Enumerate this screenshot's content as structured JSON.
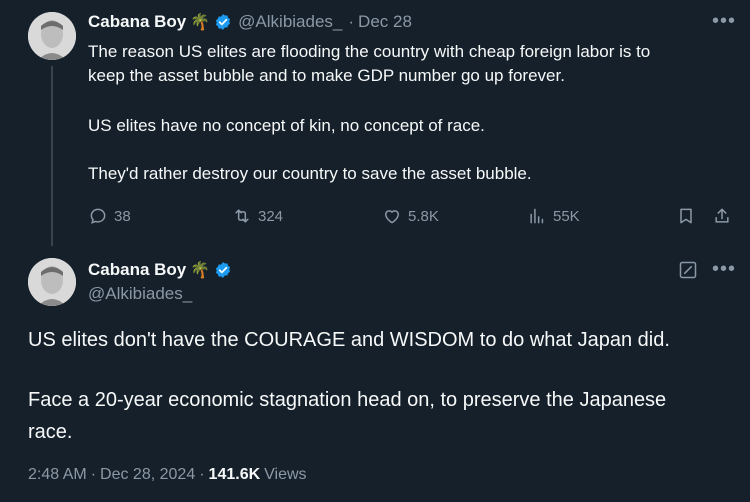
{
  "tweet1": {
    "name": "Cabana Boy",
    "handle": "@Alkibiades_",
    "separator": "·",
    "date": "Dec 28",
    "para1": "The reason US elites are flooding the country with cheap foreign labor is to",
    "para1b": "keep the asset bubble and to make GDP number go up forever.",
    "para2": "US elites have no concept of kin, no concept of race.",
    "para3": "They'd rather destroy our country to save the asset bubble.",
    "replies": "38",
    "retweets": "324",
    "likes": "5.8K",
    "views": "55K"
  },
  "tweet2": {
    "name": "Cabana Boy",
    "handle": "@Alkibiades_",
    "line1": "US elites don't have the COURAGE and WISDOM to do what Japan did.",
    "line2a": "Face a 20-year economic stagnation head on, to preserve the Japanese",
    "line2b": "race.",
    "time": "2:48 AM",
    "sep": "·",
    "date": "Dec 28, 2024",
    "sep2": "·",
    "views_count": "141.6K",
    "views_label": "Views"
  },
  "icons": {
    "palm": "🌴",
    "more": "•••"
  },
  "colors": {
    "background": "#15202b",
    "muted": "#8b98a5",
    "verified": "#1d9bf0",
    "text": "#f7f9f9"
  }
}
